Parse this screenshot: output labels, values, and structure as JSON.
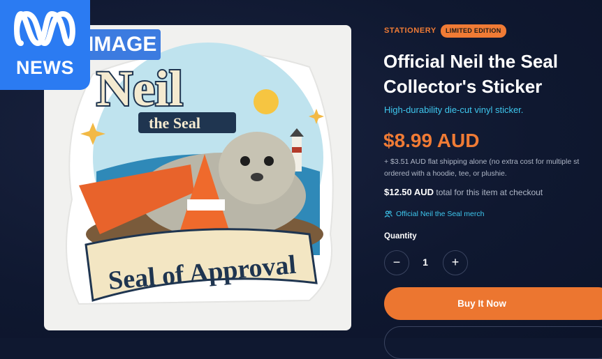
{
  "overlay": {
    "logo_text": "NEWS",
    "image_tag": "IMAGE"
  },
  "sticker": {
    "title": "Neil",
    "subtitle": "the Seal",
    "banner": "Seal of Approval"
  },
  "product": {
    "category": "STATIONERY",
    "badge": "LIMITED EDITION",
    "title": "Official Neil the Seal Collector's Sticker",
    "subtitle": "High-durability die-cut vinyl sticker.",
    "price": "$8.99 AUD",
    "shipping_line1": "+ $3.51 AUD flat shipping alone (no extra cost for multiple st",
    "shipping_line2": "ordered with a hoodie, tee, or plushie.",
    "total_amount": "$12.50 AUD",
    "total_suffix": "total for this item at checkout",
    "merch_link": "Official Neil the Seal merch",
    "quantity_label": "Quantity",
    "quantity_value": "1",
    "minus_label": "−",
    "plus_label": "+",
    "buy_label": "Buy It Now"
  },
  "colors": {
    "accent": "#f07b35",
    "link": "#3ec7ee",
    "background": "#0f1830",
    "abc_blue": "#2b7bf2"
  }
}
